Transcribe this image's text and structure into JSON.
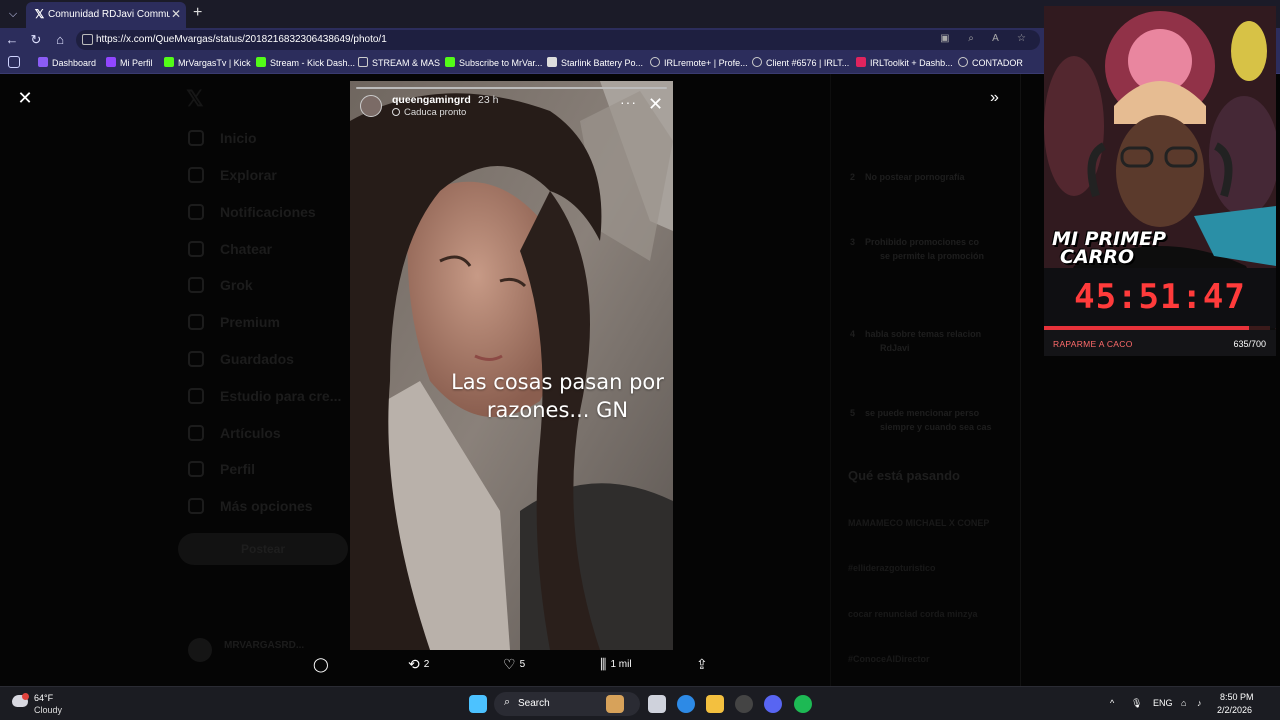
{
  "browser": {
    "tab_title": "Comunidad RDJavi Community",
    "url": "https://x.com/QueMvargas/status/2018216832306438649/photo/1",
    "bookmarks": [
      "Dashboard",
      "Mi Perfil",
      "MrVargasTv | Kick",
      "Stream - Kick Dash...",
      "STREAM & MAS",
      "Subscribe to MrVar...",
      "Starlink Battery Po...",
      "IRLremote+ | Profe...",
      "Client #6576 | IRLT...",
      "IRLToolkit + Dashb...",
      "CONTADOR"
    ]
  },
  "x_nav": {
    "items": [
      "Inicio",
      "Explorar",
      "Notificaciones",
      "Chatear",
      "Grok",
      "Premium",
      "Guardados",
      "Estudio para cre...",
      "Artículos",
      "Perfil",
      "Más opciones"
    ],
    "post_button": "Postear",
    "account": "MRVARGASRD..."
  },
  "x_right": {
    "rules": [
      {
        "n": "2",
        "text": "No postear pornografía"
      },
      {
        "n": "3",
        "text": "Prohibido promociones co"
      },
      {
        "n": "",
        "text": "se permite la promoción"
      },
      {
        "n": "4",
        "text": "habla sobre temas relacion"
      },
      {
        "n": "",
        "text": "RdJavi"
      },
      {
        "n": "5",
        "text": "se puede mencionar perso"
      },
      {
        "n": "",
        "text": "siempre y cuando sea cas"
      }
    ],
    "trends_title": "Qué está pasando",
    "trends": [
      "MAMAMECO MICHAEL X CONEP",
      "#elliderazgoturistico",
      "cocar renunciad corda minzya",
      "#ConoceAlDirector"
    ]
  },
  "story": {
    "username": "queengamingrd",
    "time": "23 h",
    "expire_label": "Caduca pronto",
    "caption_line1": "Las cosas pasan por",
    "caption_line2": "razones... GN"
  },
  "actions": {
    "retweets": "2",
    "likes": "5",
    "views": "1 mil"
  },
  "overlay": {
    "banner_line1": "MI PRIMEP",
    "banner_line2": "CARRO",
    "timer": "45:51:47",
    "goal_label": "RAPARME A CACO",
    "goal_count": "635/700",
    "goal_fraction": 0.907
  },
  "taskbar": {
    "temp": "64°F",
    "weather": "Cloudy",
    "search_label": "Search",
    "lang": "ENG",
    "time": "8:50 PM",
    "date": "2/2/2026"
  },
  "colors": {
    "browser_chrome": "#2c2d5c",
    "timer_red": "#ff3b3b",
    "accent_blue": "#1d9bf0"
  }
}
